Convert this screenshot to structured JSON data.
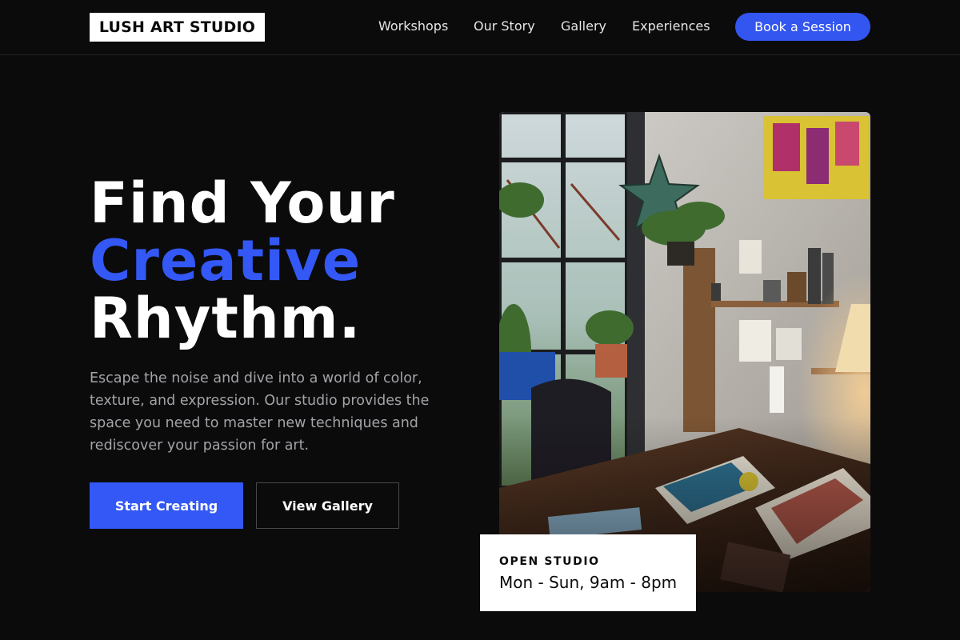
{
  "brand": {
    "name": "LUSH ART STUDIO"
  },
  "nav": {
    "links": [
      "Workshops",
      "Our Story",
      "Gallery",
      "Experiences"
    ],
    "cta": "Book a Session"
  },
  "hero": {
    "headline": {
      "line1": "Find Your",
      "line2": "Creative",
      "line3": "Rhythm."
    },
    "description": "Escape the noise and dive into a world of color, texture, and expression. Our studio provides the space you need to master new techniques and rediscover your passion for art.",
    "primary_cta": "Start Creating",
    "secondary_cta": "View Gallery"
  },
  "hours": {
    "label": "OPEN STUDIO",
    "value": "Mon - Sun, 9am - 8pm"
  },
  "colors": {
    "background": "#0b0b0c",
    "accent": "#3358f5",
    "text": "#ffffff",
    "muted_text": "#a3a3a8"
  }
}
